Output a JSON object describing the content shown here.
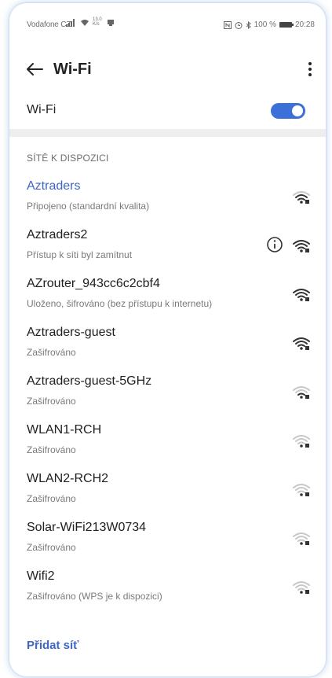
{
  "status_bar": {
    "carrier": "Vodafone CZ",
    "speed": "13.0 K/s",
    "battery": "100 %",
    "time": "20:28"
  },
  "app_bar": {
    "title": "Wi-Fi",
    "back_icon": "arrow-left-icon",
    "menu_icon": "more-vert-icon"
  },
  "wifi_toggle": {
    "label": "Wi-Fi",
    "state": "on"
  },
  "section": {
    "header": "SÍTĚ K DISPOZICI"
  },
  "networks": [
    {
      "name": "Aztraders",
      "status": "Připojeno (standardní kvalita)",
      "connected": true,
      "signal": 3,
      "has_info": false
    },
    {
      "name": "Aztraders2",
      "status": "Přístup k síti byl zamítnut",
      "connected": false,
      "signal": 4,
      "has_info": true
    },
    {
      "name": "AZrouter_943cc6c2cbf4",
      "status": "Uloženo, šifrováno (bez přístupu k internetu)",
      "connected": false,
      "signal": 4,
      "has_info": false
    },
    {
      "name": "Aztraders-guest",
      "status": "Zašifrováno",
      "connected": false,
      "signal": 4,
      "has_info": false
    },
    {
      "name": "Aztraders-guest-5GHz",
      "status": "Zašifrováno",
      "connected": false,
      "signal": 2,
      "has_info": false
    },
    {
      "name": "WLAN1-RCH",
      "status": "Zašifrováno",
      "connected": false,
      "signal": 1,
      "has_info": false
    },
    {
      "name": "WLAN2-RCH2",
      "status": "Zašifrováno",
      "connected": false,
      "signal": 1,
      "has_info": false
    },
    {
      "name": "Solar-WiFi213W0734",
      "status": "Zašifrováno",
      "connected": false,
      "signal": 1,
      "has_info": false
    },
    {
      "name": "Wifi2",
      "status": "Zašifrováno (WPS je k dispozici)",
      "connected": false,
      "signal": 1,
      "has_info": false
    }
  ],
  "add_network": {
    "label": "Přidat síť"
  },
  "colors": {
    "accent": "#3d6fd8",
    "link": "#3e66c4",
    "text_primary": "#202020",
    "text_secondary": "#7a7a7a"
  }
}
